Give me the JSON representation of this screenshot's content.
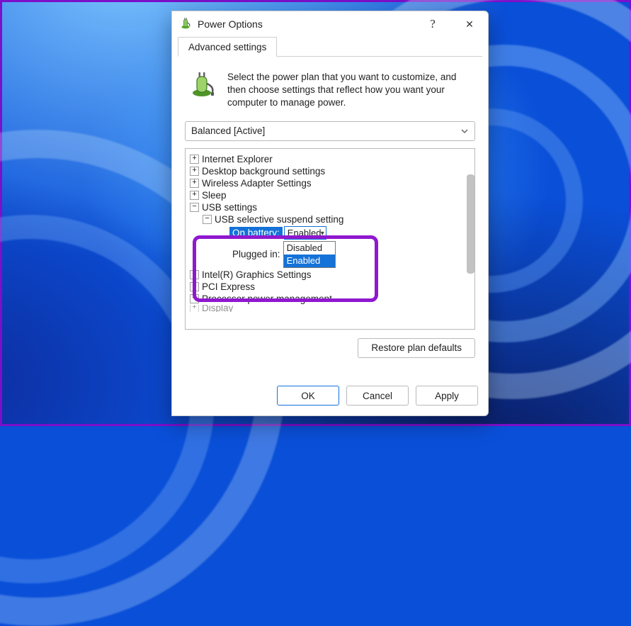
{
  "window": {
    "title": "Power Options",
    "help_icon": "?",
    "close_icon": "✕"
  },
  "tabs": {
    "advanced": "Advanced settings"
  },
  "intro": {
    "text": "Select the power plan that you want to customize, and then choose settings that reflect how you want your computer to manage power."
  },
  "plan": {
    "selected": "Balanced [Active]"
  },
  "tree": {
    "internet_explorer": "Internet Explorer",
    "desktop_bg": "Desktop background settings",
    "wireless": "Wireless Adapter Settings",
    "sleep": "Sleep",
    "usb_settings": "USB settings",
    "usb_selective": "USB selective suspend setting",
    "on_battery_label": "On battery:",
    "on_battery_value": "Enabled",
    "plugged_in_label": "Plugged in:",
    "dropdown_disabled": "Disabled",
    "dropdown_enabled": "Enabled",
    "intel_graphics": "Intel(R) Graphics Settings",
    "pci": "PCI Express",
    "processor": "Processor power management",
    "display": "Display"
  },
  "buttons": {
    "restore": "Restore plan defaults",
    "ok": "OK",
    "cancel": "Cancel",
    "apply": "Apply"
  }
}
